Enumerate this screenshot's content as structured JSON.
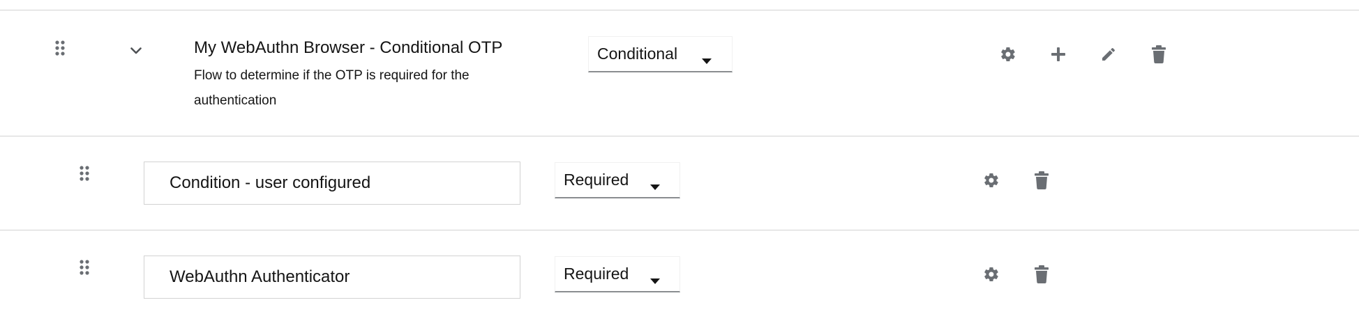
{
  "flow": {
    "title": "My WebAuthn Browser - Conditional OTP",
    "description": "Flow to determine if the OTP is required for the authentication",
    "requirement": "Conditional",
    "icons": [
      "drag-handle-icon",
      "chevron-down-icon",
      "gear-icon",
      "plus-icon",
      "pencil-icon",
      "trash-icon"
    ]
  },
  "executions": [
    {
      "name": "Condition - user configured",
      "requirement": "Required",
      "icons": [
        "drag-handle-icon",
        "gear-icon",
        "trash-icon"
      ]
    },
    {
      "name": "WebAuthn Authenticator",
      "requirement": "Required",
      "icons": [
        "drag-handle-icon",
        "gear-icon",
        "trash-icon"
      ]
    }
  ],
  "colors": {
    "icon": "#6a6e73",
    "border": "#d2d2d2",
    "select_underline": "#8a8d90",
    "text": "#151515"
  }
}
